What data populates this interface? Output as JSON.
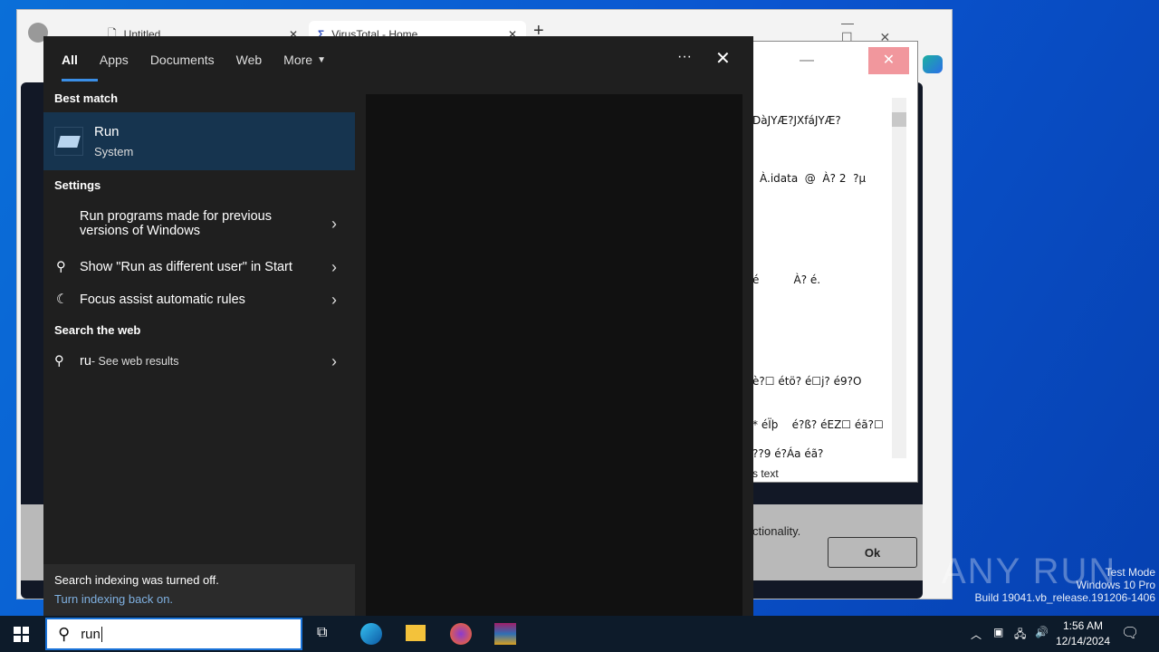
{
  "browser": {
    "tabs": [
      {
        "title": "Untitled"
      },
      {
        "title": "VirusTotal - Home"
      }
    ],
    "new_tab": "+"
  },
  "notepad": {
    "lines": [
      "DàJYÆ?JXfáJYÆ?",
      "À.idata  @  À? 2  ?µ",
      "é          À? é.",
      "è?☐ étö? é☐j? é9?O",
      "* éÏþ    é?ß? éEZ☐ éã?☐",
      "??9 é?Áa éã?"
    ],
    "status": "s text"
  },
  "dialog": {
    "text": "ctionality.",
    "ok": "Ok"
  },
  "search": {
    "tabs": [
      "All",
      "Apps",
      "Documents",
      "Web",
      "More"
    ],
    "best_match_label": "Best match",
    "best_match": {
      "title": "Run",
      "subtitle": "System"
    },
    "settings_label": "Settings",
    "settings": [
      {
        "label": "Run programs made for previous versions of Windows"
      },
      {
        "label": "Show \"Run as different user\" in Start"
      },
      {
        "label": "Focus assist automatic rules"
      }
    ],
    "web_label": "Search the web",
    "web": {
      "query": "ru",
      "suffix": " - See web results"
    },
    "footer": {
      "message": "Search indexing was turned off.",
      "link": "Turn indexing back on."
    },
    "more_icon": "ellipsis-icon",
    "close_icon": "close-icon"
  },
  "taskbar": {
    "search_value": "run",
    "time": "1:56 AM",
    "date": "12/14/2024"
  },
  "watermark": {
    "brand": "ANY RUN",
    "line1": "Test Mode",
    "line2": "Windows 10 Pro",
    "line3": "Build 19041.vb_release.191206-1406"
  },
  "colors": {
    "accent": "#3a8ee6",
    "selected": "#16344f",
    "panel": "#1f1f1f"
  }
}
